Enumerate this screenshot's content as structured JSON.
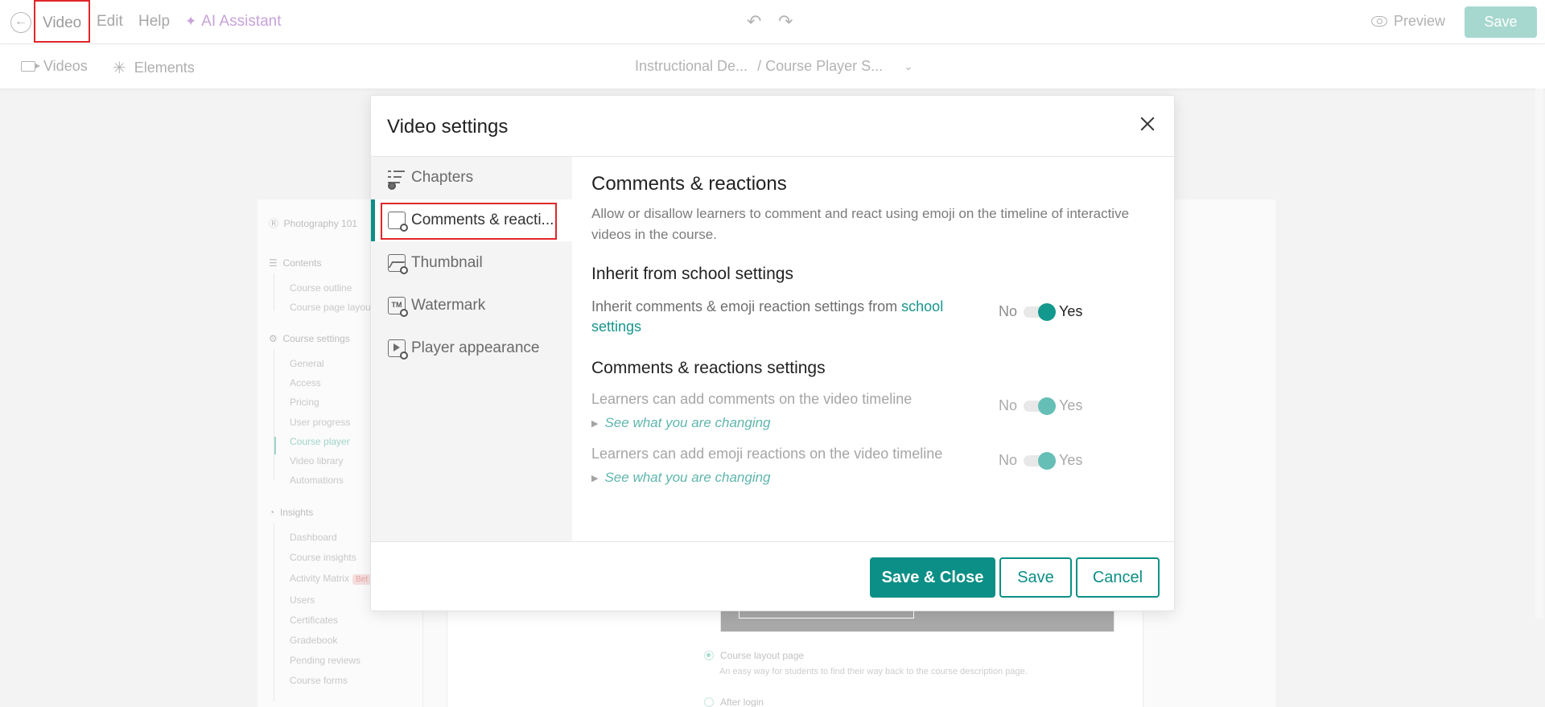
{
  "topbar": {
    "menu": [
      "Video",
      "Edit",
      "Help"
    ],
    "ai_assistant": "AI Assistant",
    "preview": "Preview",
    "save": "Save"
  },
  "subbar": {
    "videos": "Videos",
    "elements": "Elements",
    "breadcrumb_1": "Instructional De...",
    "breadcrumb_2": "/ Course Player S..."
  },
  "background": {
    "course_title": "Photography 101",
    "sections": [
      {
        "label": "Contents",
        "items": [
          "Course outline",
          "Course page layout"
        ]
      },
      {
        "label": "Course settings",
        "items": [
          "General",
          "Access",
          "Pricing",
          "User progress",
          "Course player",
          "Video library",
          "Automations"
        ]
      },
      {
        "label": "Insights",
        "items": [
          "Dashboard",
          "Course insights",
          "Activity Matrix",
          "Users",
          "Certificates",
          "Gradebook",
          "Pending reviews",
          "Course forms"
        ]
      }
    ],
    "beta_badge": "Bet",
    "option_1": "Course layout page",
    "option_1_desc": "An easy way for students to find their way back to the course description page.",
    "option_2": "After login"
  },
  "modal": {
    "title": "Video settings",
    "nav": [
      {
        "label": "Chapters",
        "icon": "chapters-icon"
      },
      {
        "label": "Comments & reacti...",
        "icon": "comments-icon"
      },
      {
        "label": "Thumbnail",
        "icon": "thumbnail-icon"
      },
      {
        "label": "Watermark",
        "icon": "watermark-icon"
      },
      {
        "label": "Player appearance",
        "icon": "player-appearance-icon"
      }
    ],
    "heading": "Comments & reactions",
    "description": "Allow or disallow learners to comment and react using emoji on the timeline of interactive videos in the course.",
    "inherit_heading": "Inherit from school settings",
    "inherit_text": "Inherit comments & emoji reaction settings from ",
    "inherit_link": "school settings",
    "settings_heading": "Comments & reactions settings",
    "setting_comments": "Learners can add comments on the video timeline",
    "setting_reactions": "Learners can add emoji reactions on the video timeline",
    "see_changes": "See what you are changing",
    "toggle_no": "No",
    "toggle_yes": "Yes",
    "buttons": {
      "save_close": "Save & Close",
      "save": "Save",
      "cancel": "Cancel"
    }
  },
  "colors": {
    "accent": "#0c8f86",
    "highlight": "#e0262a"
  }
}
